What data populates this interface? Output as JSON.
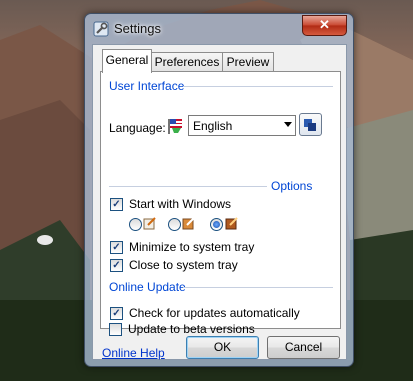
{
  "window": {
    "title": "Settings",
    "close_label": "✕"
  },
  "tabs": [
    {
      "label": "General",
      "active": true
    },
    {
      "label": "Preferences",
      "active": false
    },
    {
      "label": "Preview",
      "active": false
    }
  ],
  "user_interface": {
    "group_title": "User Interface",
    "language_label": "Language:",
    "language_value": "English"
  },
  "options": {
    "group_title": "Options",
    "start_with_windows": {
      "label": "Start with Windows",
      "checked": true
    },
    "tray_icon_style": {
      "options": [
        "style-1",
        "style-2",
        "style-3"
      ],
      "selected": "style-3"
    },
    "minimize_to_tray": {
      "label": "Minimize to system tray",
      "checked": true
    },
    "close_to_tray": {
      "label": "Close to system tray",
      "checked": true
    }
  },
  "online_update": {
    "group_title": "Online Update",
    "check_updates": {
      "label": "Check for updates automatically",
      "checked": true
    },
    "beta_versions": {
      "label": "Update to beta versions",
      "checked": false
    }
  },
  "footer": {
    "help_link": "Online Help",
    "ok_label": "OK",
    "cancel_label": "Cancel"
  },
  "check_mark": "✓"
}
